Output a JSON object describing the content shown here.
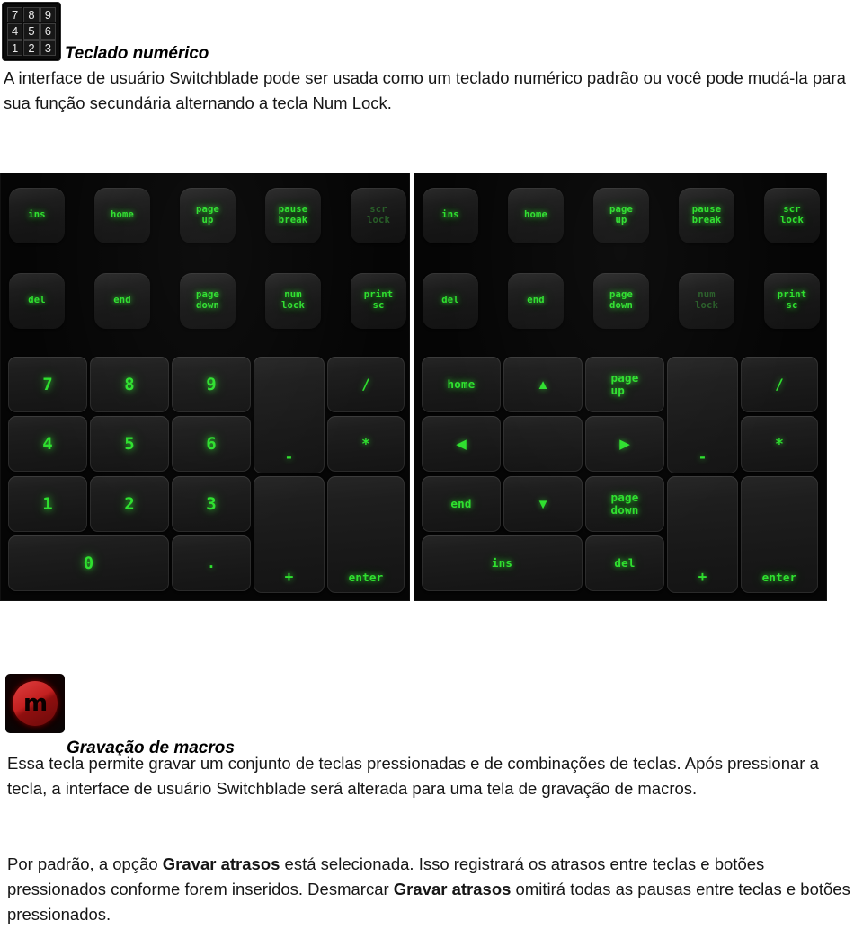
{
  "document": {
    "numpad_section": {
      "icon_name": "numeric-keypad-icon",
      "icon_keys": [
        "7",
        "8",
        "9",
        "4",
        "5",
        "6",
        "1",
        "2",
        "3"
      ],
      "heading": "Teclado numérico",
      "paragraph": "A interface de usuário Switchblade pode ser usada como um teclado numérico padrão ou você pode mudá-la para sua função secundária alternando a tecla Num Lock."
    },
    "macro_section": {
      "icon_name": "macro-recording-icon",
      "icon_glyph": "m",
      "heading": "Gravação de macros",
      "paragraph1_a": "Essa tecla permite gravar um conjunto de teclas pressionadas e de combinações de teclas. Após pressionar a tecla, a interface de usuário Switchblade será alterada para uma tela de gravação de macros.",
      "paragraph2_a": "Por padrão, a opção ",
      "paragraph2_b": "Gravar atrasos",
      "paragraph2_c": " está selecionada. Isso registrará os atrasos entre teclas e botões pressionados conforme forem inseridos. Desmarcar ",
      "paragraph2_d": "Gravar atrasos",
      "paragraph2_e": " omitirá todas as pausas entre teclas e botões pressionados."
    }
  },
  "colors": {
    "key_green": "#2fe02f",
    "key_green_dim": "#2c6a2c",
    "panel_black": "#050505",
    "macro_red": "#c32020"
  },
  "keypads": {
    "left": {
      "name": "numeric-mode-keypad",
      "function_keys": [
        {
          "label": "ins",
          "dim": false
        },
        {
          "label": "home",
          "dim": false
        },
        {
          "label": "page\nup",
          "dim": false
        },
        {
          "label": "pause\nbreak",
          "dim": false
        },
        {
          "label": "scr\nlock",
          "dim": true
        },
        {
          "label": "del",
          "dim": false
        },
        {
          "label": "end",
          "dim": false
        },
        {
          "label": "page\ndown",
          "dim": false
        },
        {
          "label": "num\nlock",
          "dim": false
        },
        {
          "label": "print\nsc",
          "dim": false
        }
      ],
      "grid_keys": [
        {
          "label": "7",
          "dim": false
        },
        {
          "label": "8",
          "dim": false
        },
        {
          "label": "9",
          "dim": false
        },
        {
          "label": "-",
          "dim": false
        },
        {
          "label": "/",
          "dim": false
        },
        {
          "label": "4",
          "dim": false
        },
        {
          "label": "5",
          "dim": false
        },
        {
          "label": "6",
          "dim": false
        },
        {
          "label": "*",
          "dim": false
        },
        {
          "label": "1",
          "dim": false
        },
        {
          "label": "2",
          "dim": false
        },
        {
          "label": "3",
          "dim": false
        },
        {
          "label": "+",
          "dim": false
        },
        {
          "label": "enter",
          "dim": false
        },
        {
          "label": "0",
          "dim": false
        },
        {
          "label": ".",
          "dim": false
        }
      ]
    },
    "right": {
      "name": "navigation-mode-keypad",
      "function_keys": [
        {
          "label": "ins",
          "dim": false
        },
        {
          "label": "home",
          "dim": false
        },
        {
          "label": "page\nup",
          "dim": false
        },
        {
          "label": "pause\nbreak",
          "dim": false
        },
        {
          "label": "scr\nlock",
          "dim": false
        },
        {
          "label": "del",
          "dim": false
        },
        {
          "label": "end",
          "dim": false
        },
        {
          "label": "page\ndown",
          "dim": false
        },
        {
          "label": "num\nlock",
          "dim": true
        },
        {
          "label": "print\nsc",
          "dim": false
        }
      ],
      "grid_keys": [
        {
          "label": "home",
          "dim": false
        },
        {
          "label": "▲",
          "dim": false
        },
        {
          "label": "page\nup",
          "dim": false
        },
        {
          "label": "-",
          "dim": false
        },
        {
          "label": "/",
          "dim": false
        },
        {
          "label": "◀",
          "dim": false
        },
        {
          "label": "",
          "dim": false
        },
        {
          "label": "▶",
          "dim": false
        },
        {
          "label": "*",
          "dim": false
        },
        {
          "label": "end",
          "dim": false
        },
        {
          "label": "▼",
          "dim": false
        },
        {
          "label": "page\ndown",
          "dim": false
        },
        {
          "label": "+",
          "dim": false
        },
        {
          "label": "enter",
          "dim": false
        },
        {
          "label": "ins",
          "dim": false
        },
        {
          "label": "del",
          "dim": false
        }
      ]
    }
  }
}
